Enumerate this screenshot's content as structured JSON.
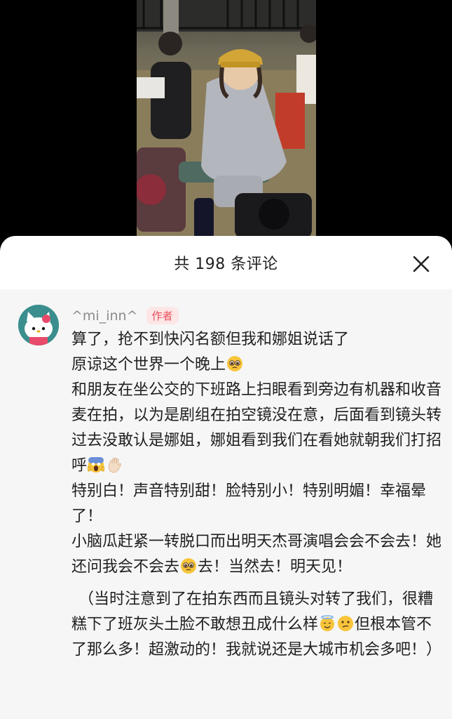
{
  "sheet": {
    "comment_count_label": "共 198 条评论"
  },
  "comment": {
    "username": "^mi_inn^",
    "badge": "作者",
    "lines": {
      "l1": "算了，抢不到快闪名额但我和娜姐说话了",
      "l2": "原谅这个世界一个晚上",
      "l3a": "和朋友在坐公交的下班路上扫眼看到旁边有机器和收音麦在拍，以为是剧组在拍空镜没在意，后面看到镜头转过去没敢认是娜姐，娜姐看到我们在看她就朝我们打招呼",
      "l4": "特别白！声音特别甜！脸特别小！特别明媚！幸福晕了！",
      "l5a": "小脑瓜赶紧一转脱口而出明天杰哥演唱会会不会去！她还问我会不会去",
      "l5b": "去！当然去！明天见！",
      "l6a": "（当时注意到了在拍东西而且镜头对转了我们，很糟糕下了班灰头土脸不敢想丑成什么样",
      "l6b": "但根本管不了那么多！超激动的！我就说还是大城市机会多吧！）"
    }
  },
  "icons": {
    "close": "close-icon",
    "pleading": "pleading-face-emoji",
    "screaming": "screaming-face-emoji",
    "waving": "waving-hand-emoji",
    "halo": "halo-face-emoji",
    "confused": "confused-face-emoji"
  },
  "colors": {
    "badge_text": "#e8505b",
    "badge_bg": "#fde6e6",
    "comment_bg": "#f6f6f6"
  }
}
